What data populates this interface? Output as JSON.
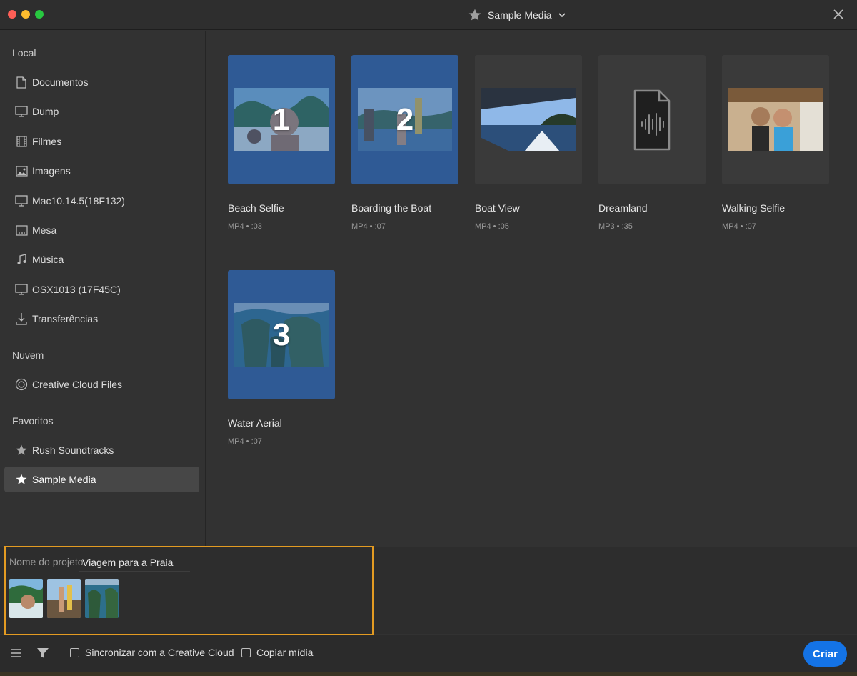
{
  "window": {
    "title": "Sample Media"
  },
  "sidebar": {
    "sections": [
      {
        "title": "Local"
      },
      {
        "title": "Nuvem"
      },
      {
        "title": "Favoritos"
      }
    ],
    "items": [
      {
        "label": "Documentos",
        "icon": "document-icon"
      },
      {
        "label": "Dump",
        "icon": "monitor-icon"
      },
      {
        "label": "Filmes",
        "icon": "film-icon"
      },
      {
        "label": "Imagens",
        "icon": "image-icon"
      },
      {
        "label": "Mac10.14.5(18F132)",
        "icon": "monitor-icon"
      },
      {
        "label": "Mesa",
        "icon": "desktop-icon"
      },
      {
        "label": "Música",
        "icon": "music-icon"
      },
      {
        "label": "OSX1013 (17F45C)",
        "icon": "monitor-icon"
      },
      {
        "label": "Transferências",
        "icon": "download-icon"
      },
      {
        "label": "Creative Cloud Files",
        "icon": "creative-cloud-icon"
      },
      {
        "label": "Rush Soundtracks",
        "icon": "star-icon"
      },
      {
        "label": "Sample Media",
        "icon": "star-icon",
        "active": true
      }
    ]
  },
  "media": [
    {
      "title": "Beach Selfie",
      "meta": "MP4 • :03",
      "selected_number": "1"
    },
    {
      "title": "Boarding the Boat",
      "meta": "MP4 • :07",
      "selected_number": "2"
    },
    {
      "title": "Boat View",
      "meta": "MP4 • :05"
    },
    {
      "title": "Dreamland",
      "meta": "MP3 • :35"
    },
    {
      "title": "Walking Selfie",
      "meta": "MP4 • :07"
    },
    {
      "title": "Water Aerial",
      "meta": "MP4 • :07",
      "selected_number": "3"
    }
  ],
  "project": {
    "name_label": "Nome do projeto",
    "name_value": "Viagem para a Praia"
  },
  "footer": {
    "sync_label": "Sincronizar com a Creative Cloud",
    "copy_label": "Copiar mídia",
    "create_label": "Criar"
  },
  "colors": {
    "accent": "#1473e6",
    "selection": "#2f5a95",
    "highlight_border": "#e39b22"
  }
}
